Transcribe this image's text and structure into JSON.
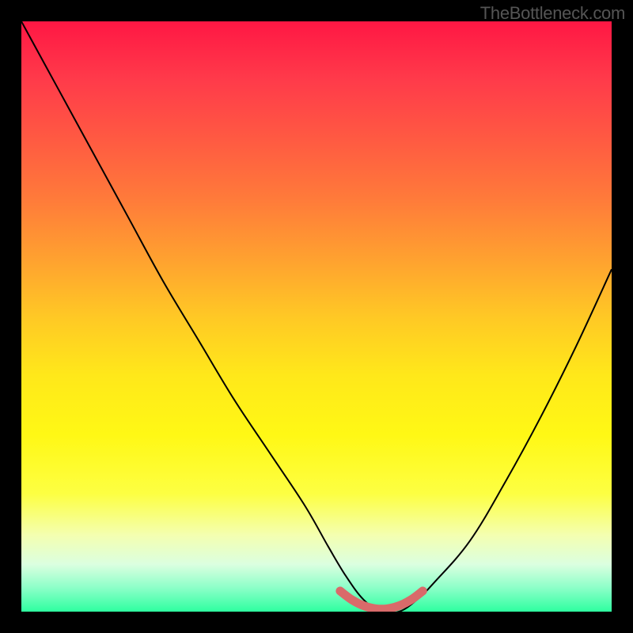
{
  "watermark": "TheBottleneck.com",
  "chart_data": {
    "type": "line",
    "title": "",
    "xlabel": "",
    "ylabel": "",
    "xlim": [
      0,
      100
    ],
    "ylim": [
      0,
      100
    ],
    "series": [
      {
        "name": "bottleneck-curve",
        "x": [
          0,
          6,
          12,
          18,
          24,
          30,
          36,
          42,
          48,
          52,
          55,
          58,
          61,
          64,
          67,
          70,
          76,
          82,
          88,
          94,
          100
        ],
        "y": [
          100,
          89,
          78,
          67,
          56,
          46,
          36,
          27,
          18,
          11,
          6,
          2,
          0,
          0,
          2,
          5,
          12,
          22,
          33,
          45,
          58
        ],
        "color": "#000000"
      },
      {
        "name": "optimal-zone",
        "x": [
          54,
          56,
          58,
          60,
          62,
          64,
          66,
          68
        ],
        "y": [
          3.5,
          2,
          1,
          0.5,
          0.5,
          1,
          2,
          3.5
        ],
        "color": "#d96a6a"
      }
    ]
  }
}
